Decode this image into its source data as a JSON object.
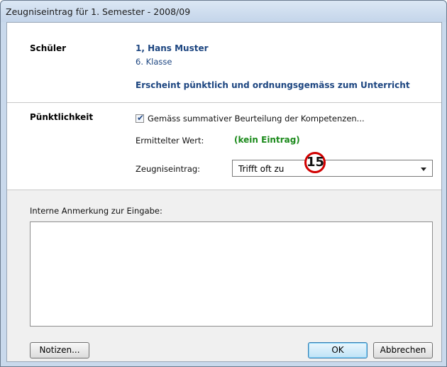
{
  "window": {
    "title": "Zeugniseintrag für 1. Semester - 2008/09"
  },
  "student": {
    "label": "Schüler",
    "name": "1, Hans Muster",
    "class": "6. Klasse",
    "criterion": "Erscheint pünktlich und ordnungsgemäss zum Unterricht"
  },
  "punctuality": {
    "label": "Pünktlichkeit",
    "checkbox_label": "Gemäss summativer Beurteilung der Kompetenzen...",
    "checkbox_checked": true,
    "determined_label": "Ermittelter Wert:",
    "determined_value": "(kein Eintrag)",
    "entry_label": "Zeugniseintrag:",
    "entry_value": "Trifft oft zu"
  },
  "callout": {
    "number": "15"
  },
  "notes": {
    "label": "Interne Anmerkung zur Eingabe:",
    "value": ""
  },
  "buttons": {
    "notes": "Notizen...",
    "ok": "OK",
    "cancel": "Abbrechen"
  }
}
